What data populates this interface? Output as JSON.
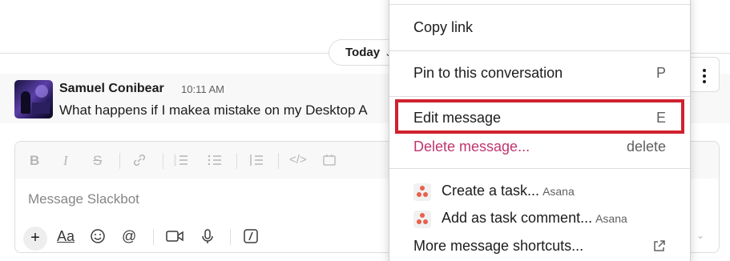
{
  "date_divider": {
    "label": "Today",
    "chevron": "⌄"
  },
  "message": {
    "author": "Samuel Conibear",
    "time": "10:11 AM",
    "text": "What happens if I makea mistake on my Desktop A"
  },
  "more_actions_icon": "vertical-dots",
  "composer": {
    "placeholder": "Message Slackbot",
    "format_tools": [
      "bold",
      "italic",
      "strikethrough",
      "link",
      "ordered-list",
      "bulleted-list",
      "blockquote",
      "code",
      "code-block"
    ],
    "bottom_tools": [
      "plus",
      "text-format",
      "emoji",
      "mention",
      "video",
      "microphone",
      "slash-command"
    ],
    "text_format_label": "Aa"
  },
  "context_menu": {
    "items": [
      {
        "label": "Copy link",
        "shortcut": ""
      },
      {
        "label": "Pin to this conversation",
        "shortcut": "P"
      },
      {
        "label": "Edit message",
        "shortcut": "E",
        "highlighted": true
      },
      {
        "label": "Delete message...",
        "shortcut": "delete",
        "danger": true
      },
      {
        "label": "Create a task...",
        "app": "Asana"
      },
      {
        "label": "Add as task comment...",
        "app": "Asana"
      },
      {
        "label": "More message shortcuts...",
        "icon": "external-link"
      }
    ]
  },
  "colors": {
    "highlight_border": "#d0212f",
    "danger_text": "#c0366e",
    "asana": "#e8604c"
  }
}
